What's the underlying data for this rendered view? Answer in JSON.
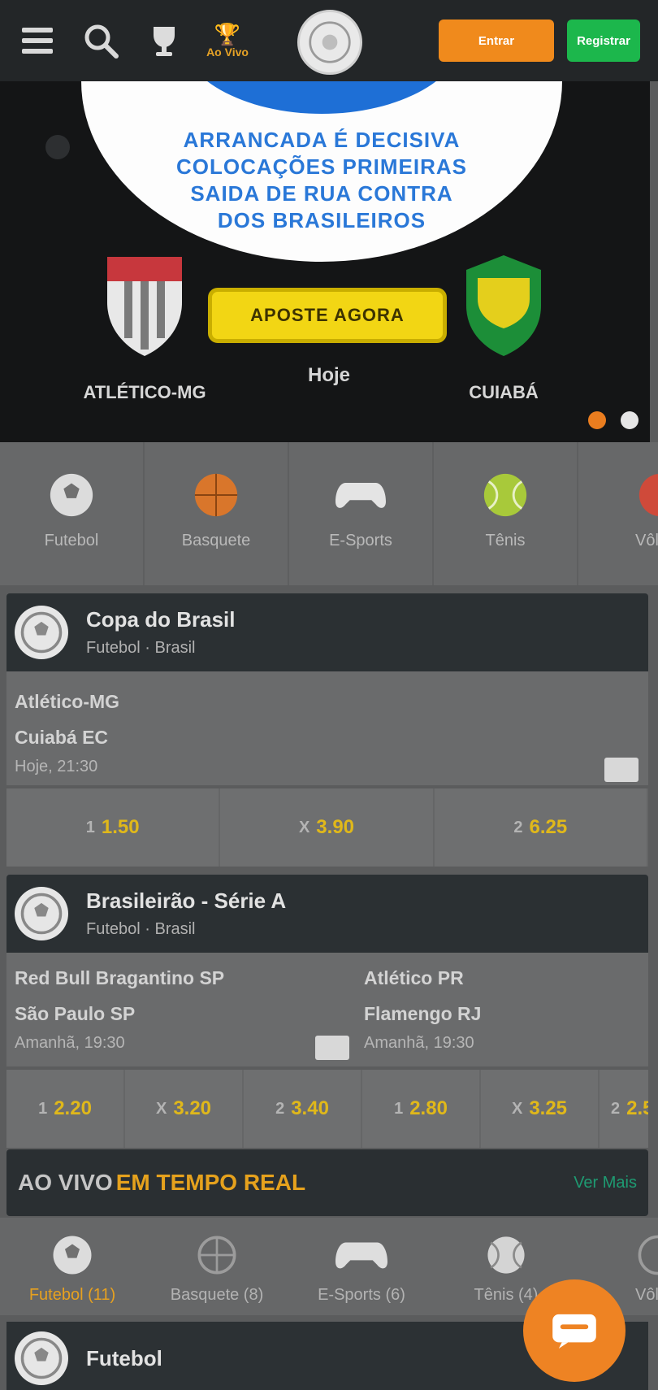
{
  "header": {
    "menu_icon": "menu-icon",
    "search_icon": "search-icon",
    "trophy_label": "Ao Vivo",
    "logo_text": "",
    "login_label": "Entrar",
    "signup_label": "Registrar"
  },
  "banner": {
    "lines": [
      "ARRANCADA É DECISIVA",
      "COLOCAÇÕES PRIMEIRAS",
      "SAIDA DE RUA CONTRA",
      "DOS BRASILEIROS"
    ],
    "team_left": "ATLÉTICO-MG",
    "team_right": "CUIABÁ",
    "cta_label": "APOSTE AGORA",
    "cta_sub": "Hoje",
    "slide_count": 2
  },
  "sports_nav": [
    {
      "label": "Futebol",
      "icon": "soccer-ball-icon"
    },
    {
      "label": "Basquete",
      "icon": "basketball-icon"
    },
    {
      "label": "E-Sports",
      "icon": "gamepad-icon"
    },
    {
      "label": "Tênis",
      "icon": "tennis-ball-icon"
    },
    {
      "label": "Vôlei",
      "icon": "volleyball-icon"
    }
  ],
  "match1": {
    "league": "Copa do Brasil",
    "sub": "Futebol · Brasil",
    "home": "Atlético-MG",
    "away": "Cuiabá EC",
    "time": "Hoje, 21:30",
    "odds": [
      {
        "label": "1",
        "value": "1.50"
      },
      {
        "label": "X",
        "value": "3.90"
      },
      {
        "label": "2",
        "value": "6.25"
      }
    ]
  },
  "match2": {
    "league": "Brasileirão - Série A",
    "sub": "Futebol · Brasil",
    "left": {
      "home": "Red Bull Bragantino SP",
      "away": "São Paulo SP",
      "time": "Amanhã, 19:30"
    },
    "right": {
      "home": "Atlético PR",
      "away": "Flamengo RJ",
      "time": "Amanhã, 19:30"
    },
    "odds": [
      {
        "label": "1",
        "value": "2.20"
      },
      {
        "label": "X",
        "value": "3.20"
      },
      {
        "label": "2",
        "value": "3.40"
      },
      {
        "label": "1",
        "value": "2.80"
      },
      {
        "label": "X",
        "value": "3.25"
      },
      {
        "label": "2",
        "value": "2.5"
      }
    ]
  },
  "live": {
    "title_a": "AO VIVO",
    "title_b": "EM TEMPO REAL",
    "see_all": "Ver Mais",
    "tabs": [
      {
        "label": "Futebol (11)",
        "icon": "soccer-ball-icon",
        "active": true
      },
      {
        "label": "Basquete (8)",
        "icon": "basketball-icon",
        "active": false
      },
      {
        "label": "E-Sports (6)",
        "icon": "gamepad-icon",
        "active": false
      },
      {
        "label": "Tênis (4)",
        "icon": "tennis-ball-icon",
        "active": false
      },
      {
        "label": "Vôlei",
        "icon": "volleyball-icon",
        "active": false
      }
    ],
    "bottom_league": "Futebol"
  },
  "chat": {
    "icon": "chat-icon"
  },
  "colors": {
    "accent": "#ee8323",
    "odds": "#e0b81a",
    "green": "#1cb74c"
  }
}
